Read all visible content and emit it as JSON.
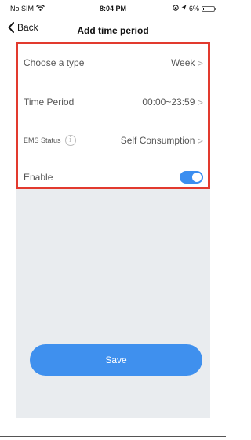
{
  "status_bar": {
    "carrier": "No SIM",
    "time": "8:04 PM",
    "battery": "6%",
    "battery_level": 0.06
  },
  "nav": {
    "back_label": "Back",
    "title": "Add time period"
  },
  "form": {
    "rows": [
      {
        "label": "Choose a type",
        "value": "Week"
      },
      {
        "label": "Time Period",
        "value": "00:00~23:59"
      },
      {
        "label": "EMS Status",
        "value": "Self Consumption",
        "info_icon": "info-icon"
      },
      {
        "label": "Enable",
        "toggle_on": true
      }
    ]
  },
  "actions": {
    "save_label": "Save"
  },
  "colors": {
    "accent": "#3f90ee",
    "highlight_border": "#e23a2e",
    "background": "#e9ecef"
  }
}
